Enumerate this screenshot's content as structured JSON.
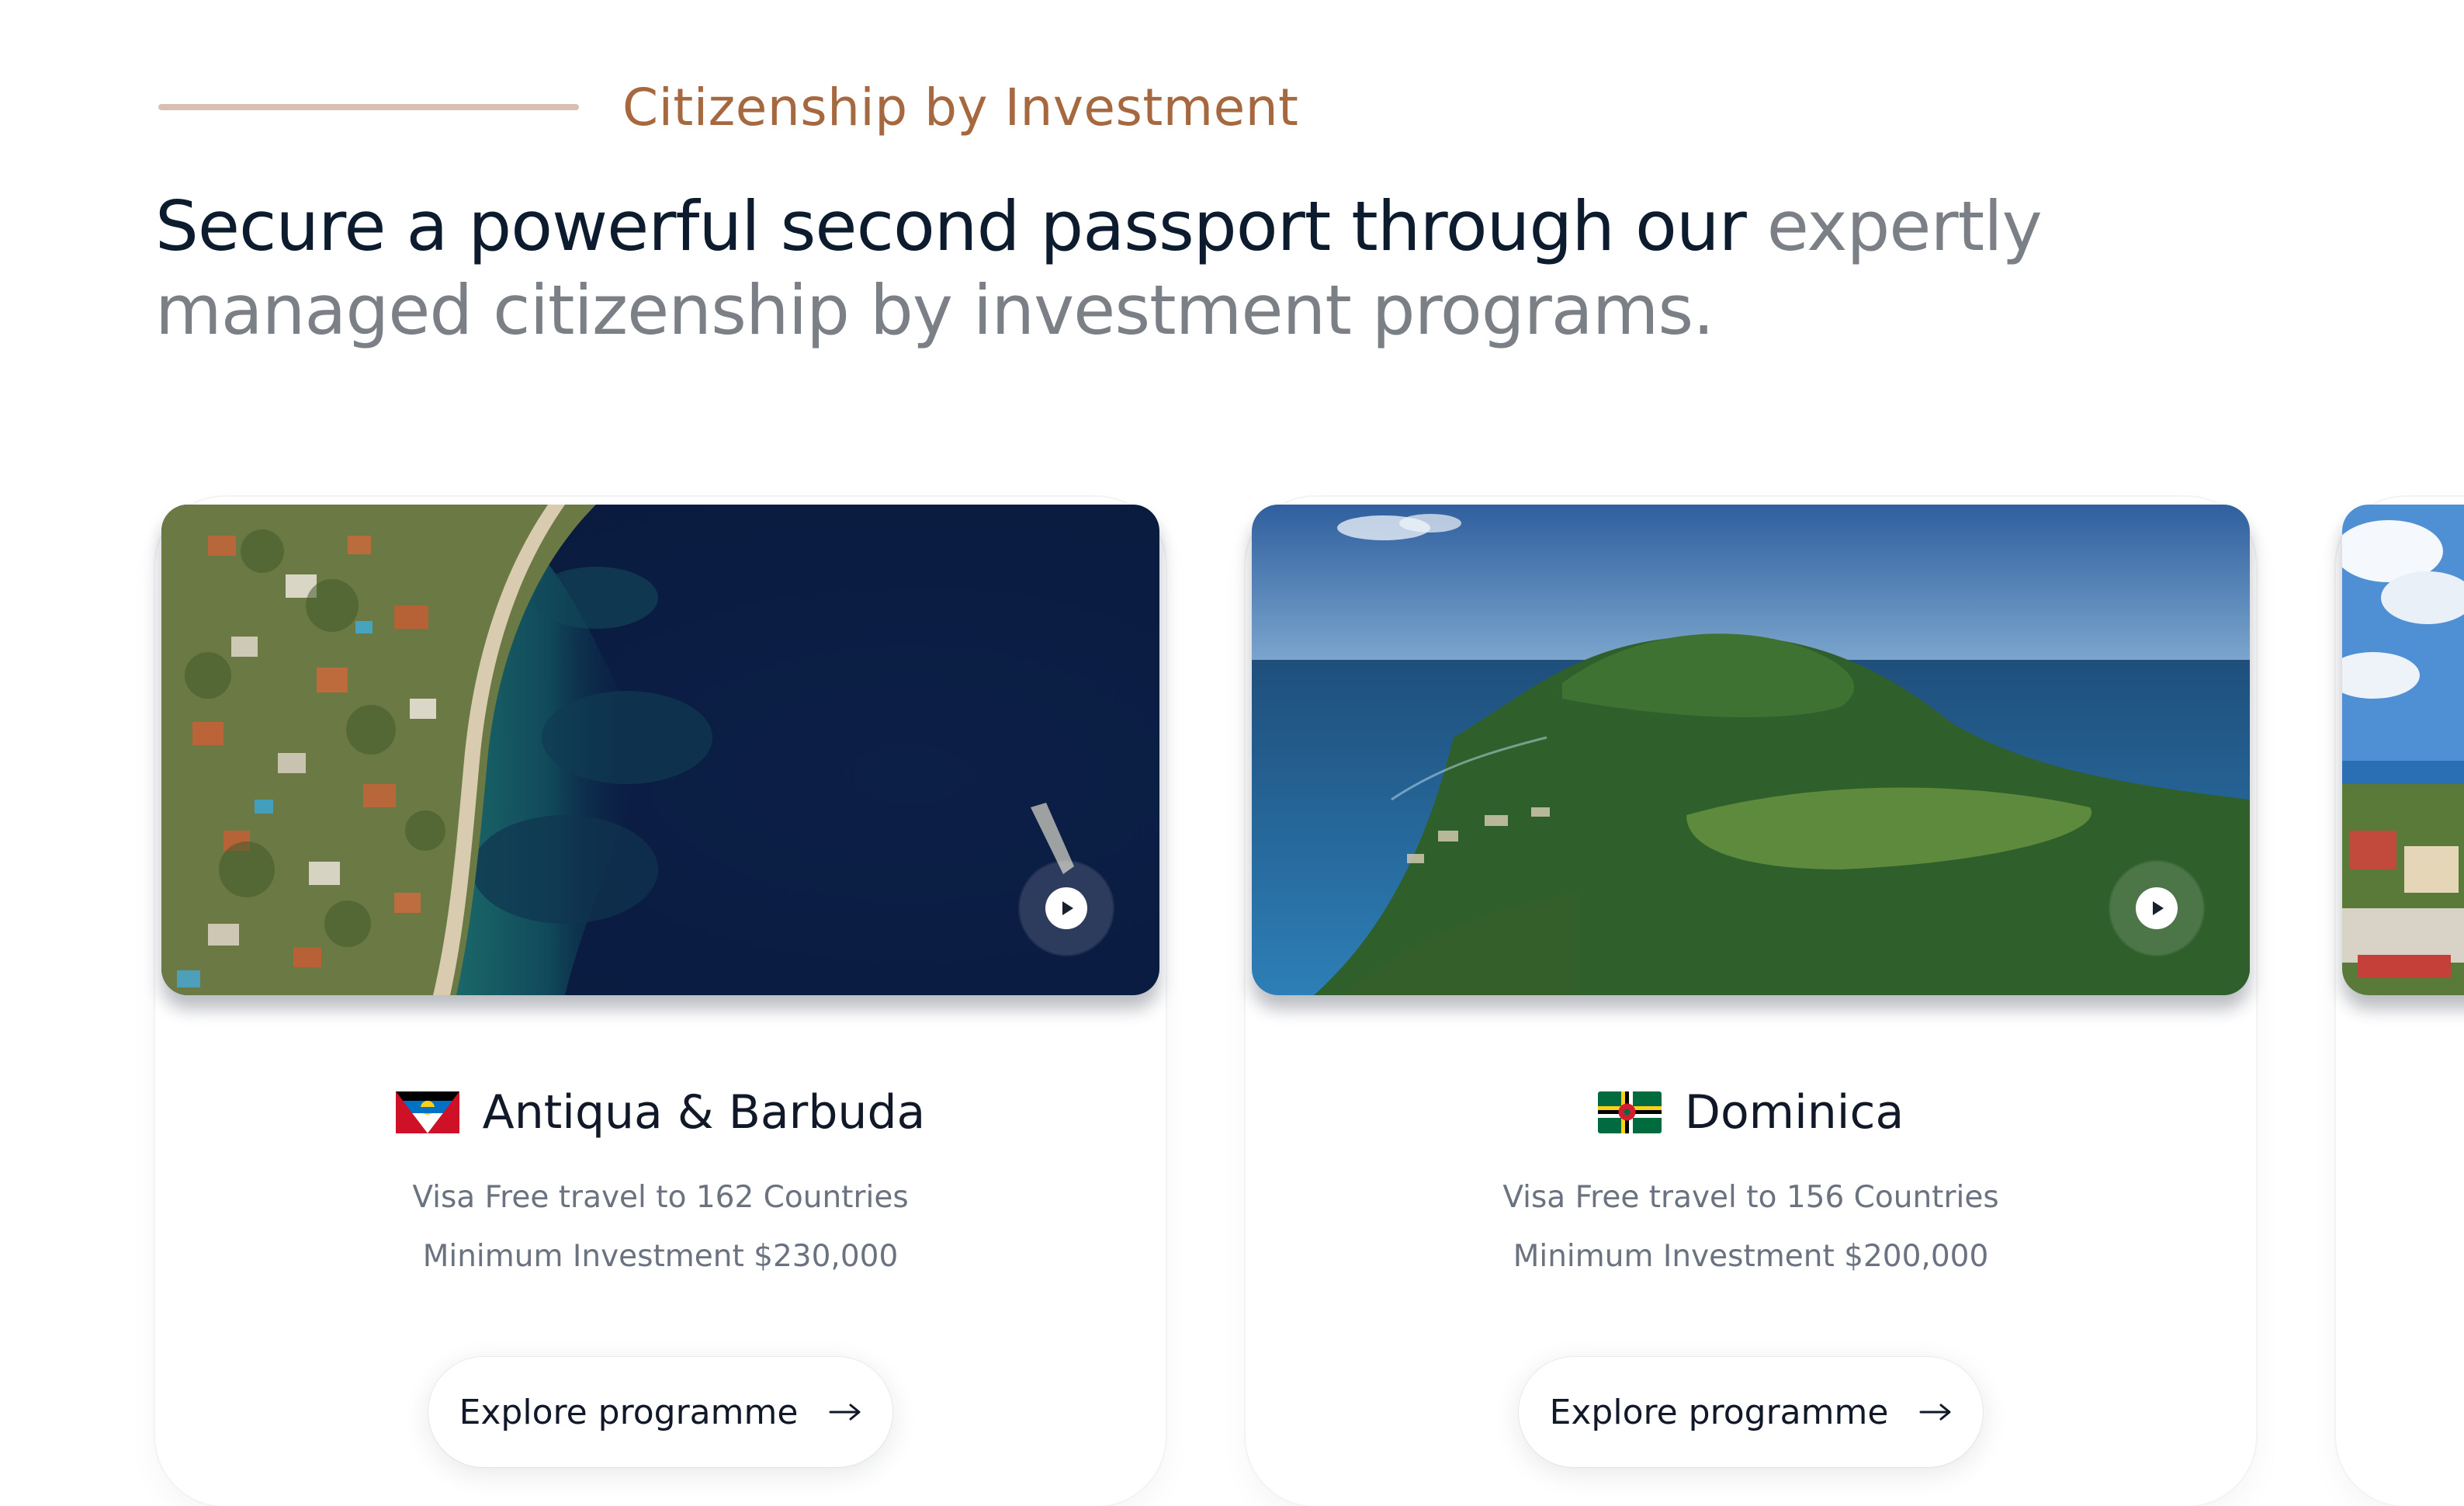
{
  "section": {
    "eyebrow": "Citizenship by Investment",
    "headline_strong": "Secure a powerful second passport through our",
    "headline_muted": "expertly managed citizenship by investment programs."
  },
  "cards": [
    {
      "country": "Antiqua & Barbuda",
      "flag_icon": "antigua-barbuda-flag",
      "visa_free": "Visa Free travel to 162 Countries",
      "min_investment": "Minimum Investment $230,000",
      "cta": "Explore programme",
      "image": "aerial-coastline-photo",
      "play_icon": "play-icon"
    },
    {
      "country": "Dominica",
      "flag_icon": "dominica-flag",
      "visa_free": "Visa Free travel to 156 Countries",
      "min_investment": "Minimum Investment $200,000",
      "cta": "Explore programme",
      "image": "green-peninsula-photo",
      "play_icon": "play-icon"
    },
    {
      "image": "harbor-town-photo"
    }
  ],
  "colors": {
    "eyebrow": "#a6683f",
    "eyebrow_line": "#d8bfb2",
    "headline_strong": "#0d1b2e",
    "headline_muted": "#7b7f86",
    "body_text": "#6b7280"
  }
}
